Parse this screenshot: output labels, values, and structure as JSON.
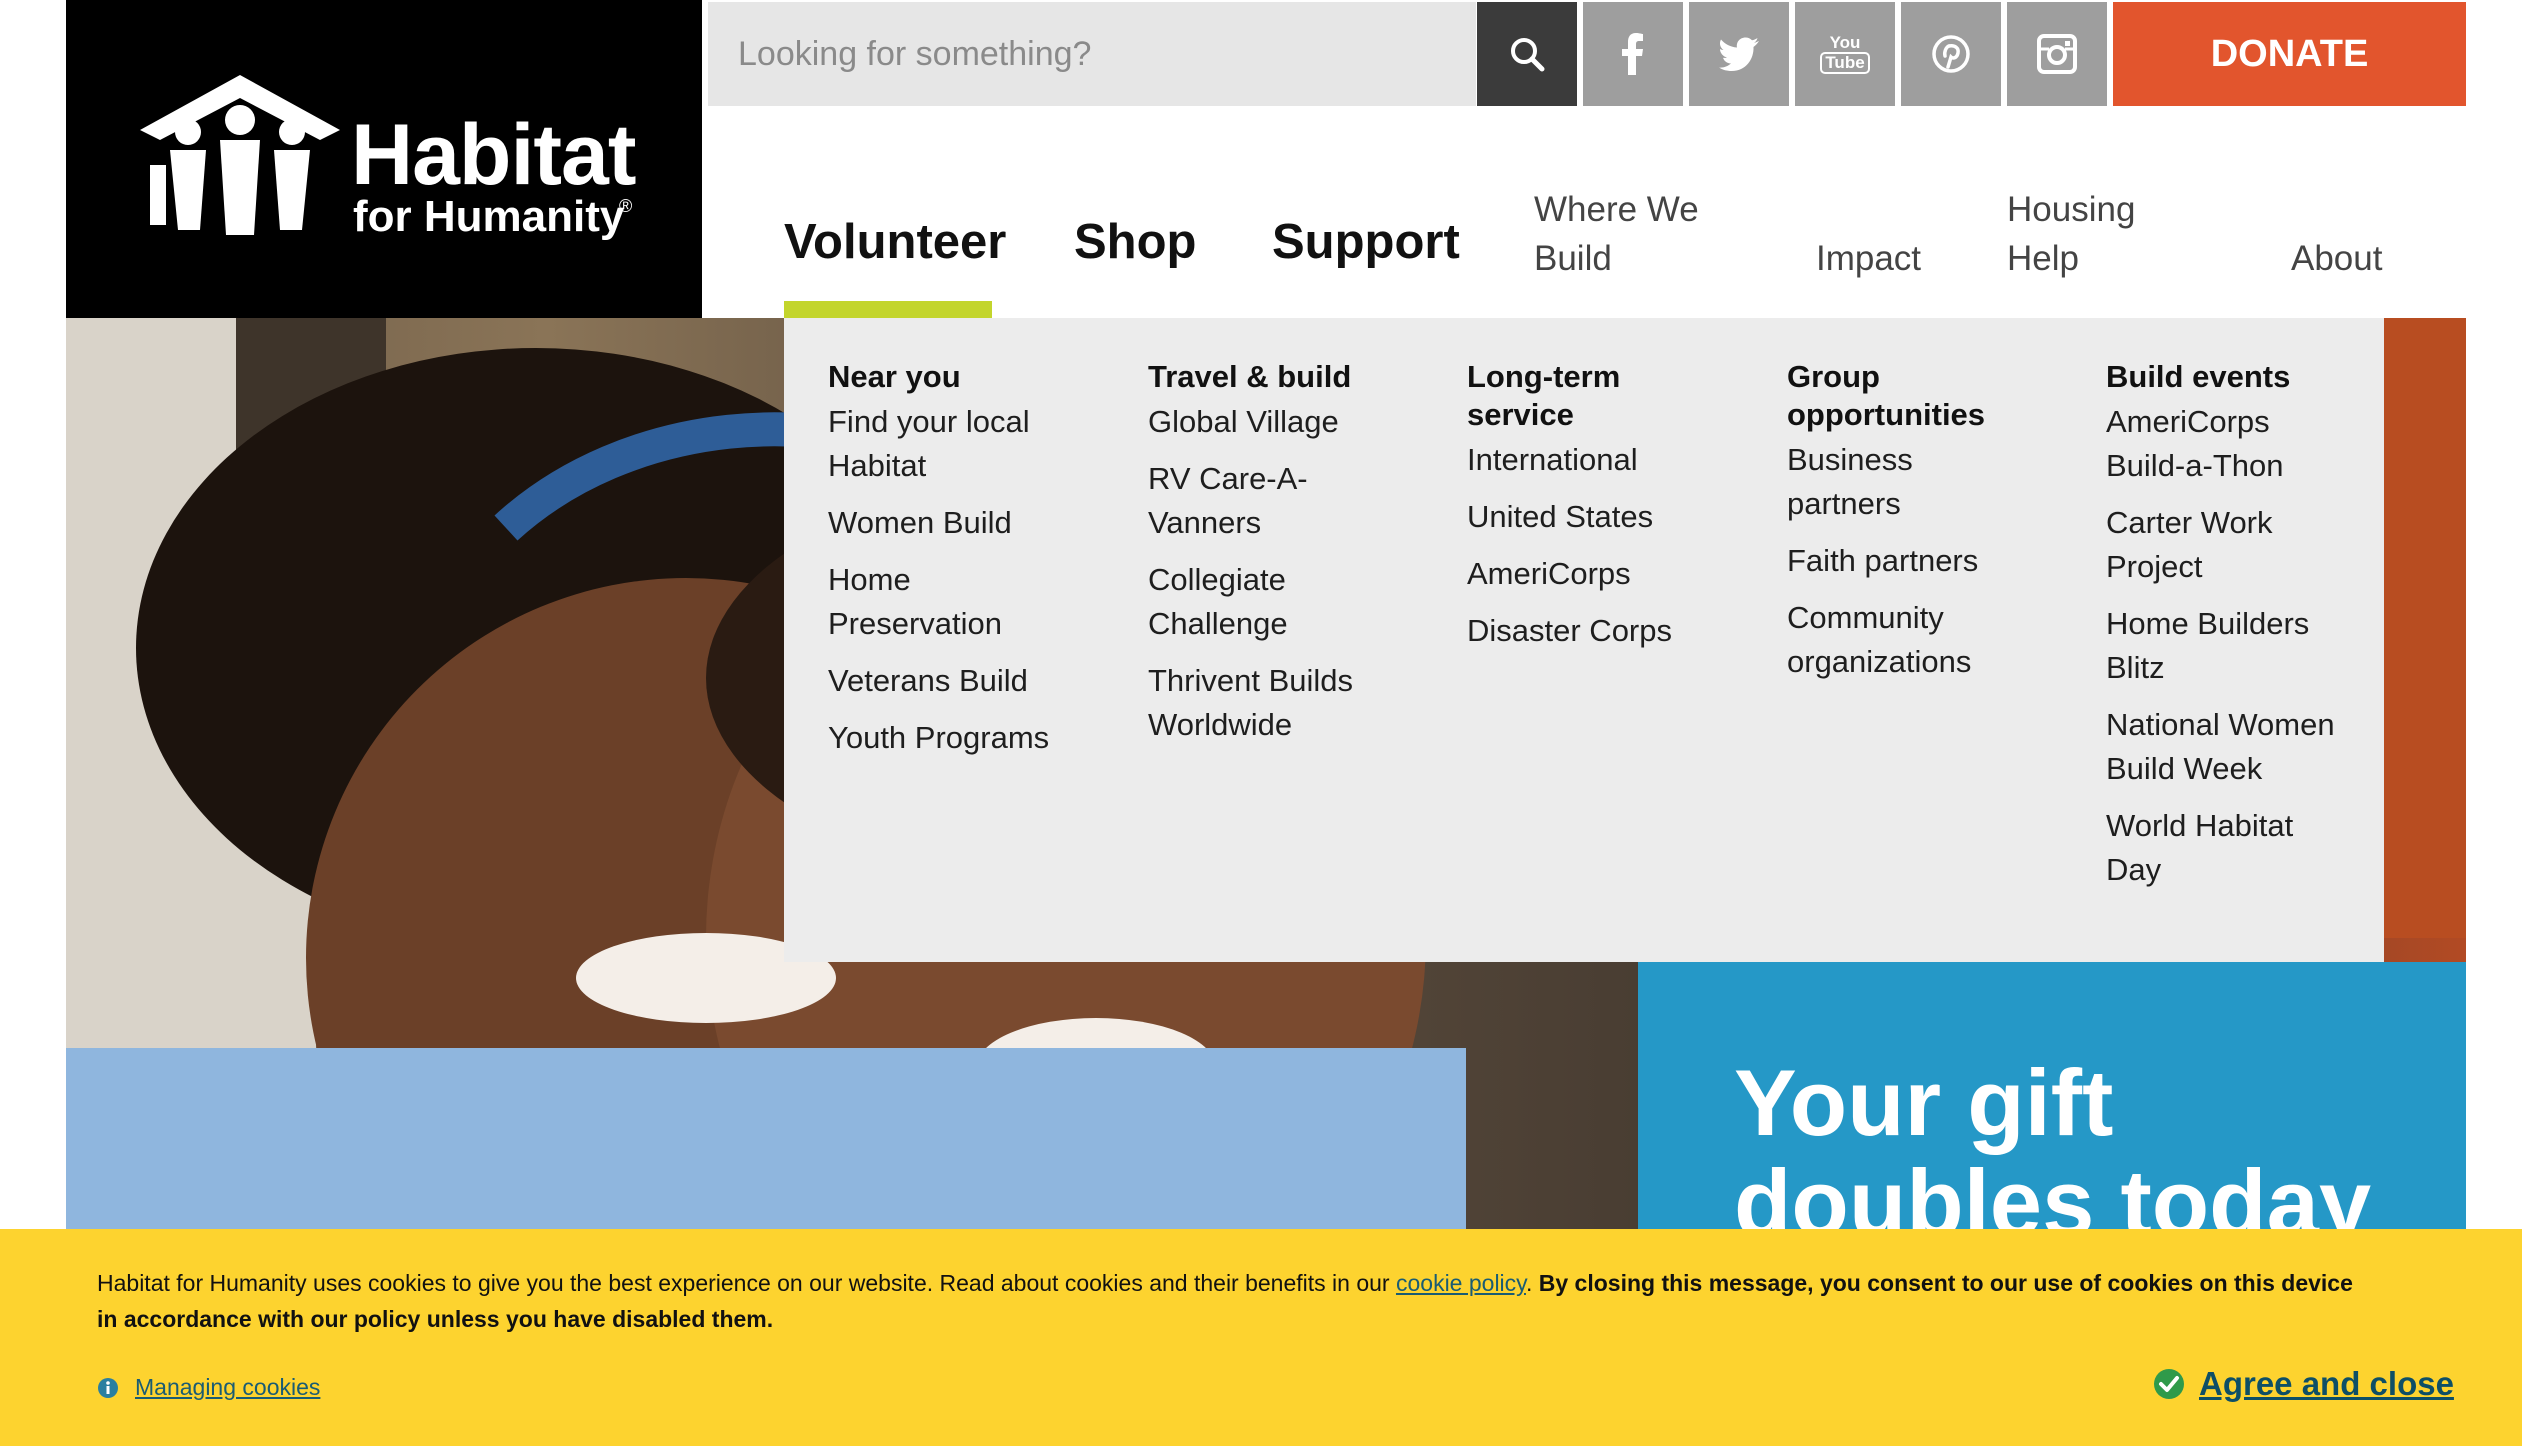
{
  "logo": {
    "title": "Habitat",
    "subtitle": "for Humanity",
    "registered": "®"
  },
  "search": {
    "placeholder": "Looking for something?"
  },
  "icons": {
    "search": "search-icon",
    "facebook": "facebook-icon",
    "twitter": "twitter-icon",
    "youtube": "youtube-icon",
    "pinterest": "pinterest-icon",
    "instagram": "instagram-icon"
  },
  "youtube_glyph": {
    "top": "You",
    "bottom": "Tube"
  },
  "donate": "DONATE",
  "nav": {
    "volunteer": "Volunteer",
    "shop": "Shop",
    "support": "Support",
    "where_line1": "Where We",
    "where_line2": "Build",
    "impact": "Impact",
    "housing_line1": "Housing",
    "housing_line2": "Help",
    "about": "About"
  },
  "dropdown": {
    "columns": [
      {
        "heading_lines": [
          "Near you"
        ],
        "items": [
          [
            "Find your local",
            "Habitat"
          ],
          [
            "Women Build"
          ],
          [
            "Home",
            "Preservation"
          ],
          [
            "Veterans Build"
          ],
          [
            "Youth Programs"
          ]
        ]
      },
      {
        "heading_lines": [
          "Travel & build"
        ],
        "items": [
          [
            "Global Village"
          ],
          [
            "RV Care-A-",
            "Vanners"
          ],
          [
            "Collegiate",
            "Challenge"
          ],
          [
            "Thrivent Builds",
            "Worldwide"
          ]
        ]
      },
      {
        "heading_lines": [
          "Long-term",
          "service"
        ],
        "items": [
          [
            "International"
          ],
          [
            "United States"
          ],
          [
            "AmeriCorps"
          ],
          [
            "Disaster Corps"
          ]
        ]
      },
      {
        "heading_lines": [
          "Group",
          "opportunities"
        ],
        "items": [
          [
            "Business",
            "partners"
          ],
          [
            "Faith partners"
          ],
          [
            "Community",
            "organizations"
          ]
        ]
      },
      {
        "heading_lines": [
          "Build events"
        ],
        "items": [
          [
            "AmeriCorps",
            "Build-a-Thon"
          ],
          [
            "Carter Work",
            "Project"
          ],
          [
            "Home Builders",
            "Blitz"
          ],
          [
            "National Women",
            "Build Week"
          ],
          [
            "World Habitat",
            "Day"
          ]
        ]
      }
    ]
  },
  "hero": {
    "gift_line1": "Your gift",
    "gift_line2": "doubles today"
  },
  "cookie": {
    "text_before": "Habitat for Humanity uses cookies to give you the best experience on our website. Read about cookies and their benefits in our ",
    "link": "cookie policy",
    "text_after": ". ",
    "strong": "By closing this message, you consent to our use of cookies on this device in accordance with our policy unless you have disabled them.",
    "managing": "Managing cookies",
    "agree": "Agree and close"
  },
  "colors": {
    "brand_black": "#000000",
    "donate": "#e2552d",
    "underline": "#c3d52c",
    "cookie_bg": "#fdd32f",
    "blue_panel": "#2598c7"
  }
}
